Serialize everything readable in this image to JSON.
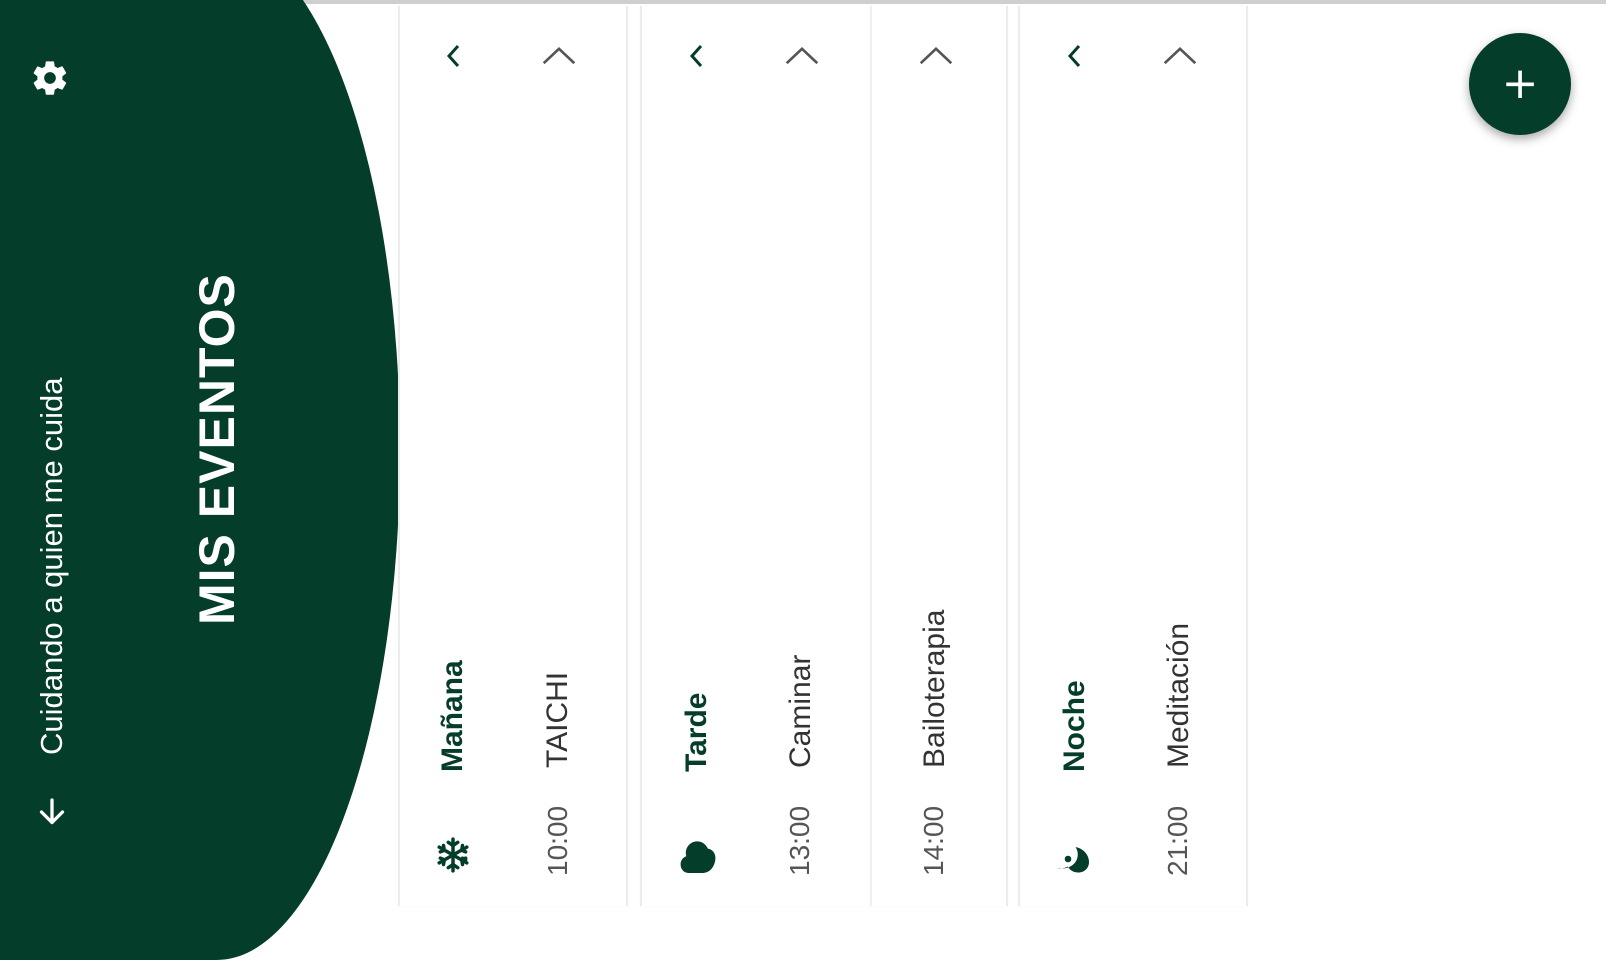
{
  "header": {
    "title": "MIS EVENTOS",
    "subtitle": "Cuidando a quien me cuida",
    "settings_icon": "gear-icon",
    "down_icon": "arrow-down-icon",
    "color": "#043d29"
  },
  "sections": [
    {
      "period": "Mañana",
      "icon": "snowflake-icon",
      "events": [
        {
          "time": "10:00",
          "activity": "TAICHI"
        }
      ]
    },
    {
      "period": "Tarde",
      "icon": "cloud-icon",
      "events": [
        {
          "time": "13:00",
          "activity": "Caminar"
        },
        {
          "time": "14:00",
          "activity": "Bailoterapia"
        }
      ]
    },
    {
      "period": "Noche",
      "icon": "moon-icon",
      "events": [
        {
          "time": "21:00",
          "activity": "Meditación"
        }
      ]
    }
  ],
  "fab": {
    "label": "+",
    "icon": "plus-icon"
  }
}
